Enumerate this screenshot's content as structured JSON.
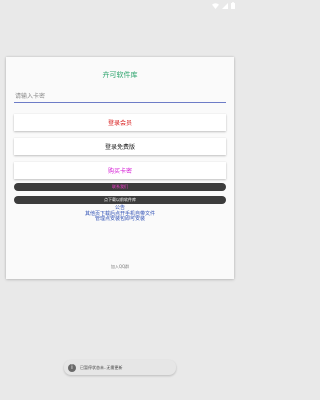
{
  "card": {
    "title": "卉可软件库",
    "input_placeholder": "请输入卡密",
    "login_member": "登录会员",
    "login_free": "登录免费版",
    "buy_key": "购买卡密",
    "pill_1": "联系我们",
    "pill_2": "点下载以前软件库",
    "notice": [
      "公告",
      "其他页下载后点开手机自带文件",
      "管理点安装包即可安装"
    ],
    "footer": "加入QQ群"
  },
  "toast": {
    "text": "已暂停状态未..无需更新"
  },
  "colors": {
    "title": "#2aa36b",
    "login_member": "#d81b1b",
    "buy_key": "#d413d4",
    "notice": "#2d4fb5",
    "pill_bg": "#3c3c3c"
  },
  "icons": {
    "status": [
      "wifi-icon",
      "signal-icon",
      "battery-icon"
    ],
    "toast": "info-icon"
  }
}
